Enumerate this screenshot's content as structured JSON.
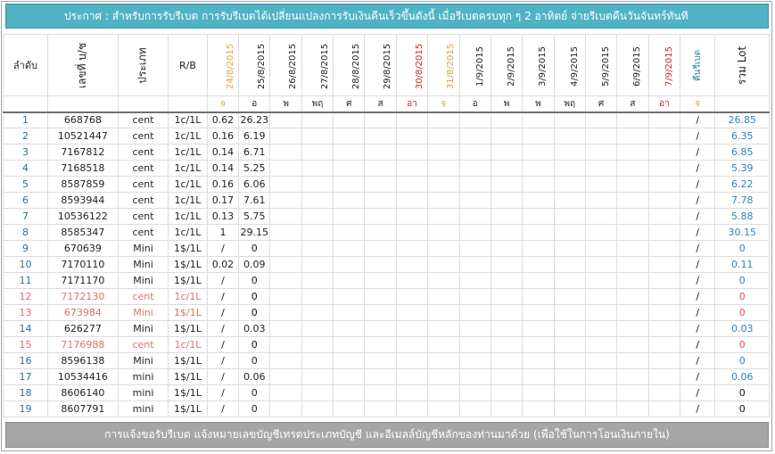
{
  "announcement": "ประกาศ : สำหรับการรับรีเบต  การรับรีเบตได้เปลี่ยนแปลงการรับเงินคืนเร็วขึ้นดังนี้   เมื่อรีเบตครบทุก ๆ 2 อาทิตย์ จ่ายรีเบตคืนวันจันทร์ทันที",
  "footer_text": "การแจ้งขอรับรีเบต  แจ้งหมายเลขบัญชีเทรดประเภทบัญชี และอีเมลล์บัญชีหลักของท่านมาด้วย   (เพื่อใช้ในการโอนเงินภายใน)",
  "headers": {
    "order": "ลำดับ",
    "account": "เลขที่ บ/ช",
    "type": "ประเภท",
    "rb": "R/B",
    "dates": [
      {
        "label": "24/8/2015",
        "color": "#e0a040"
      },
      {
        "label": "25/8/2015",
        "color": "#222222"
      },
      {
        "label": "26/8/2015",
        "color": "#222222"
      },
      {
        "label": "27/8/2015",
        "color": "#222222"
      },
      {
        "label": "28/8/2015",
        "color": "#222222"
      },
      {
        "label": "29/8/2015",
        "color": "#222222"
      },
      {
        "label": "30/8/2015",
        "color": "#cc2222"
      },
      {
        "label": "31/8/2015",
        "color": "#e0a040"
      },
      {
        "label": "1/9/2015",
        "color": "#222222"
      },
      {
        "label": "2/9/2015",
        "color": "#222222"
      },
      {
        "label": "3/9/2015",
        "color": "#222222"
      },
      {
        "label": "4/9/2015",
        "color": "#222222"
      },
      {
        "label": "5/9/2015",
        "color": "#222222"
      },
      {
        "label": "6/9/2015",
        "color": "#222222"
      },
      {
        "label": "7/9/2015",
        "color": "#cc2222"
      }
    ],
    "refund": "คืนรีเบต",
    "total_lot": "รวม Lot"
  },
  "day_row": [
    {
      "text": "จ",
      "color": "#e0a040"
    },
    {
      "text": "อ",
      "color": "#222222"
    },
    {
      "text": "พ",
      "color": "#222222"
    },
    {
      "text": "พฤ",
      "color": "#222222"
    },
    {
      "text": "ศ",
      "color": "#222222"
    },
    {
      "text": "ส",
      "color": "#222222"
    },
    {
      "text": "อา",
      "color": "#cc2222"
    },
    {
      "text": "จ",
      "color": "#e0a040"
    },
    {
      "text": "อ",
      "color": "#222222"
    },
    {
      "text": "พ",
      "color": "#222222"
    },
    {
      "text": "พ",
      "color": "#222222"
    },
    {
      "text": "พฤ",
      "color": "#222222"
    },
    {
      "text": "ศ",
      "color": "#222222"
    },
    {
      "text": "ส",
      "color": "#222222"
    },
    {
      "text": "อา",
      "color": "#cc2222"
    },
    {
      "text": "จ",
      "color": "#e0a040"
    }
  ],
  "rows": [
    {
      "no": "1",
      "account": "668768",
      "type": "cent",
      "rb": "1c/1L",
      "d0": "0.62",
      "d1": "26.23",
      "refund": "/",
      "total": "26.85",
      "style": "normal"
    },
    {
      "no": "2",
      "account": "10521447",
      "type": "cent",
      "rb": "1c/1L",
      "d0": "0.16",
      "d1": "6.19",
      "refund": "/",
      "total": "6.35",
      "style": "normal"
    },
    {
      "no": "3",
      "account": "7167812",
      "type": "cent",
      "rb": "1c/1L",
      "d0": "0.14",
      "d1": "6.71",
      "refund": "/",
      "total": "6.85",
      "style": "normal"
    },
    {
      "no": "4",
      "account": "7168518",
      "type": "cent",
      "rb": "1c/1L",
      "d0": "0.14",
      "d1": "5.25",
      "refund": "/",
      "total": "5.39",
      "style": "normal"
    },
    {
      "no": "5",
      "account": "8587859",
      "type": "cent",
      "rb": "1c/1L",
      "d0": "0.16",
      "d1": "6.06",
      "refund": "/",
      "total": "6.22",
      "style": "normal"
    },
    {
      "no": "6",
      "account": "8593944",
      "type": "cent",
      "rb": "1c/1L",
      "d0": "0.17",
      "d1": "7.61",
      "refund": "/",
      "total": "7.78",
      "style": "normal"
    },
    {
      "no": "7",
      "account": "10536122",
      "type": "cent",
      "rb": "1c/1L",
      "d0": "0.13",
      "d1": "5.75",
      "refund": "/",
      "total": "5.88",
      "style": "normal"
    },
    {
      "no": "8",
      "account": "8585347",
      "type": "cent",
      "rb": "1c/1L",
      "d0": "1",
      "d1": "29.15",
      "refund": "/",
      "total": "30.15",
      "style": "normal"
    },
    {
      "no": "9",
      "account": "670639",
      "type": "Mini",
      "rb": "1$/1L",
      "d0": "/",
      "d1": "0",
      "refund": "/",
      "total": "0",
      "style": "normal"
    },
    {
      "no": "10",
      "account": "7170110",
      "type": "Mini",
      "rb": "1$/1L",
      "d0": "0.02",
      "d1": "0.09",
      "refund": "/",
      "total": "0.11",
      "style": "normal"
    },
    {
      "no": "11",
      "account": "7171170",
      "type": "Mini",
      "rb": "1$/1L",
      "d0": "/",
      "d1": "0",
      "refund": "/",
      "total": "0",
      "style": "normal"
    },
    {
      "no": "12",
      "account": "7172130",
      "type": "cent",
      "rb": "1c/1L",
      "d0": "/",
      "d1": "0",
      "refund": "/",
      "total": "0",
      "style": "pink"
    },
    {
      "no": "13",
      "account": "673984",
      "type": "Mini",
      "rb": "1$/1L",
      "d0": "/",
      "d1": "0",
      "refund": "/",
      "total": "0",
      "style": "pink"
    },
    {
      "no": "14",
      "account": "626277",
      "type": "Mini",
      "rb": "1$/1L",
      "d0": "/",
      "d1": "0.03",
      "refund": "/",
      "total": "0.03",
      "style": "normal"
    },
    {
      "no": "15",
      "account": "7176988",
      "type": "cent",
      "rb": "1c/1L",
      "d0": "/",
      "d1": "0",
      "refund": "/",
      "total": "0",
      "style": "pink"
    },
    {
      "no": "16",
      "account": "8596138",
      "type": "Mini",
      "rb": "1$/1L",
      "d0": "/",
      "d1": "0",
      "refund": "/",
      "total": "0",
      "style": "normal"
    },
    {
      "no": "17",
      "account": "10534416",
      "type": "mini",
      "rb": "1$/1L",
      "d0": "/",
      "d1": "0.06",
      "refund": "/",
      "total": "0.06",
      "style": "normal"
    },
    {
      "no": "18",
      "account": "8606140",
      "type": "mini",
      "rb": "1$/1L",
      "d0": "/",
      "d1": "0",
      "refund": "/",
      "total": "0",
      "style": "black"
    },
    {
      "no": "19",
      "account": "8607791",
      "type": "mini",
      "rb": "1$/1L",
      "d0": "/",
      "d1": "0",
      "refund": "/",
      "total": "0",
      "style": "black"
    }
  ],
  "colors": {
    "banner_bg": "#4fb3c5",
    "footer_bg": "#a6a6a6",
    "total_blue": "#2a86b8",
    "pink_text": "#e0706a",
    "sunday_red": "#cc2222",
    "monday_orange": "#e0a040"
  }
}
